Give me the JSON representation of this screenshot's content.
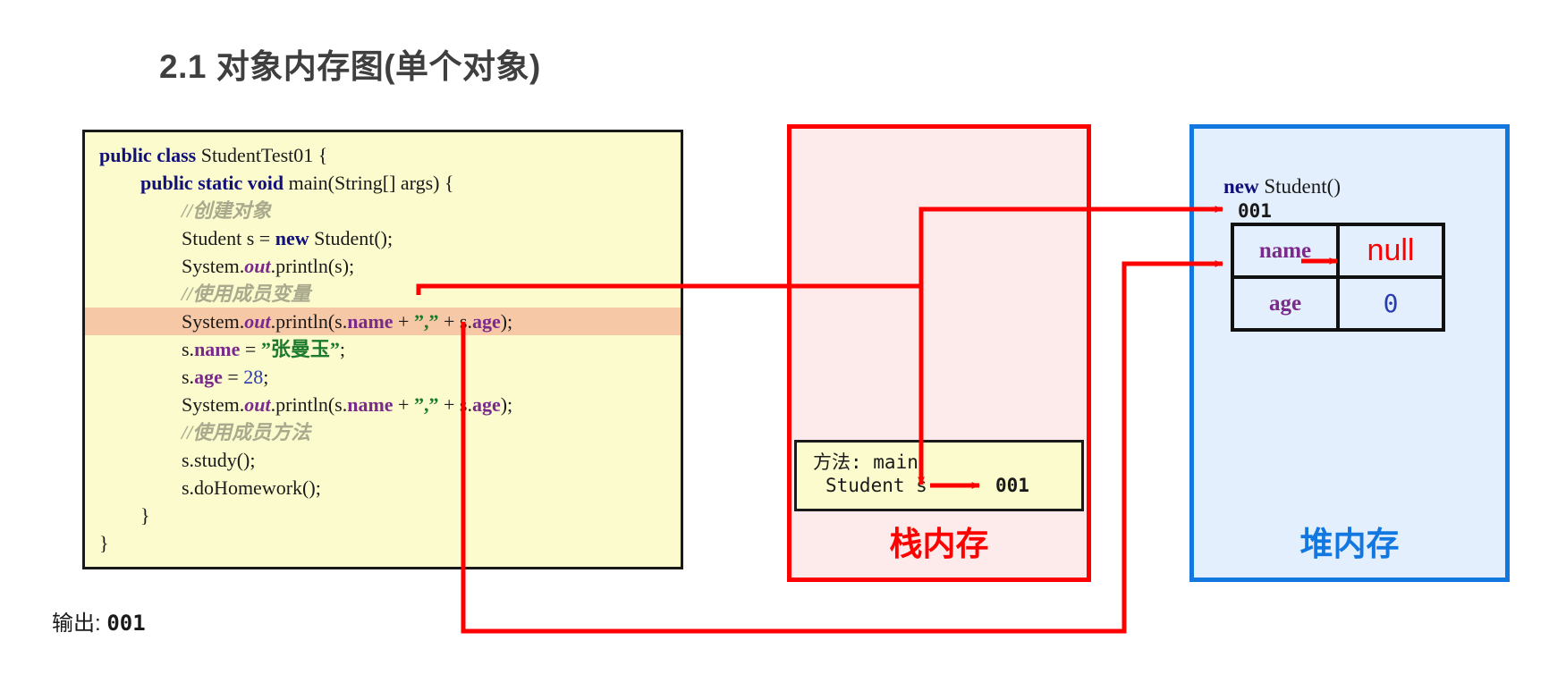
{
  "page": {
    "title": "2.1 对象内存图(单个对象)"
  },
  "code_panel": {
    "name": "java-source-code",
    "lines": [
      {
        "id": "l1",
        "indent": 1,
        "parts": [
          {
            "t": "public class ",
            "c": "kw"
          },
          {
            "t": "StudentTest01 {",
            "c": ""
          }
        ]
      },
      {
        "id": "l2",
        "indent": 2,
        "parts": [
          {
            "t": "public static void ",
            "c": "kw"
          },
          {
            "t": "main(String[] args) {",
            "c": ""
          }
        ]
      },
      {
        "id": "l3",
        "indent": 3,
        "parts": [
          {
            "t": "//创建对象",
            "c": "cmt"
          }
        ]
      },
      {
        "id": "l4",
        "indent": 3,
        "parts": [
          {
            "t": "Student s = ",
            "c": ""
          },
          {
            "t": "new ",
            "c": "kw"
          },
          {
            "t": "Student();",
            "c": ""
          }
        ]
      },
      {
        "id": "l5",
        "indent": 3,
        "parts": [
          {
            "t": "System.",
            "c": ""
          },
          {
            "t": "out",
            "c": "ital"
          },
          {
            "t": ".println(s);",
            "c": ""
          }
        ]
      },
      {
        "id": "l6",
        "indent": 3,
        "parts": [
          {
            "t": "//使用成员变量",
            "c": "cmt"
          }
        ]
      },
      {
        "id": "l7",
        "indent": 3,
        "highlight": true,
        "parts": [
          {
            "t": "System.",
            "c": ""
          },
          {
            "t": "out",
            "c": "ital"
          },
          {
            "t": ".println(s.",
            "c": ""
          },
          {
            "t": "name",
            "c": "fld"
          },
          {
            "t": " + ",
            "c": ""
          },
          {
            "t": "”,”",
            "c": "str"
          },
          {
            "t": " + s.",
            "c": ""
          },
          {
            "t": "age",
            "c": "fld"
          },
          {
            "t": ");",
            "c": ""
          }
        ]
      },
      {
        "id": "l8",
        "indent": 3,
        "parts": [
          {
            "t": "s.",
            "c": ""
          },
          {
            "t": "name",
            "c": "fld"
          },
          {
            "t": " = ",
            "c": ""
          },
          {
            "t": "”张曼玉”",
            "c": "str"
          },
          {
            "t": ";",
            "c": ""
          }
        ]
      },
      {
        "id": "l9",
        "indent": 3,
        "parts": [
          {
            "t": "s.",
            "c": ""
          },
          {
            "t": "age",
            "c": "fld"
          },
          {
            "t": " = ",
            "c": ""
          },
          {
            "t": "28",
            "c": "num"
          },
          {
            "t": ";",
            "c": ""
          }
        ]
      },
      {
        "id": "l10",
        "indent": 3,
        "parts": [
          {
            "t": "System.",
            "c": ""
          },
          {
            "t": "out",
            "c": "ital"
          },
          {
            "t": ".println(s.",
            "c": ""
          },
          {
            "t": "name",
            "c": "fld"
          },
          {
            "t": " + ",
            "c": ""
          },
          {
            "t": "”,”",
            "c": "str"
          },
          {
            "t": " + s.",
            "c": ""
          },
          {
            "t": "age",
            "c": "fld"
          },
          {
            "t": ");",
            "c": ""
          }
        ]
      },
      {
        "id": "l11",
        "indent": 3,
        "parts": [
          {
            "t": "//使用成员方法",
            "c": "cmt"
          }
        ]
      },
      {
        "id": "l12",
        "indent": 3,
        "parts": [
          {
            "t": "s.study();",
            "c": ""
          }
        ]
      },
      {
        "id": "l13",
        "indent": 3,
        "parts": [
          {
            "t": "s.doHomework();",
            "c": ""
          }
        ]
      },
      {
        "id": "l14",
        "indent": 2,
        "parts": [
          {
            "t": "}",
            "c": ""
          }
        ]
      },
      {
        "id": "l15",
        "indent": 1,
        "parts": [
          {
            "t": "}",
            "c": ""
          }
        ]
      }
    ]
  },
  "stack": {
    "label": "栈内存",
    "border_color": "#fd0000",
    "fill_color": "#fdeaea",
    "frame": {
      "method_line": "方法: main",
      "variable": "Student s",
      "address": "001"
    }
  },
  "heap": {
    "label": "堆内存",
    "border_color": "#1278e0",
    "fill_color": "#e3effc",
    "object_title_keyword": "new",
    "object_title_rest": " Student()",
    "address": "001",
    "fields": [
      {
        "name": "name",
        "value": "null",
        "value_kind": "null"
      },
      {
        "name": "age",
        "value": "0",
        "value_kind": "zero"
      }
    ]
  },
  "output": {
    "label": "输出:",
    "value": "001"
  },
  "arrows": {
    "color": "#fd0000",
    "items": [
      {
        "name": "arrow-s-to-heap-object",
        "desc": "from code highlighted line up and right to heap address 001"
      },
      {
        "name": "arrow-s-name-to-heap-name",
        "desc": "from code s.name down, right and up into heap name cell"
      },
      {
        "name": "arrow-stack-to-frame",
        "desc": "vertical red line down into stack frame Student s"
      },
      {
        "name": "arrow-frame-to-address",
        "desc": "short red arrow from Student s to 001 inside frame"
      },
      {
        "name": "arrow-name-to-null",
        "desc": "red arrow from name cell to null cell"
      }
    ]
  }
}
